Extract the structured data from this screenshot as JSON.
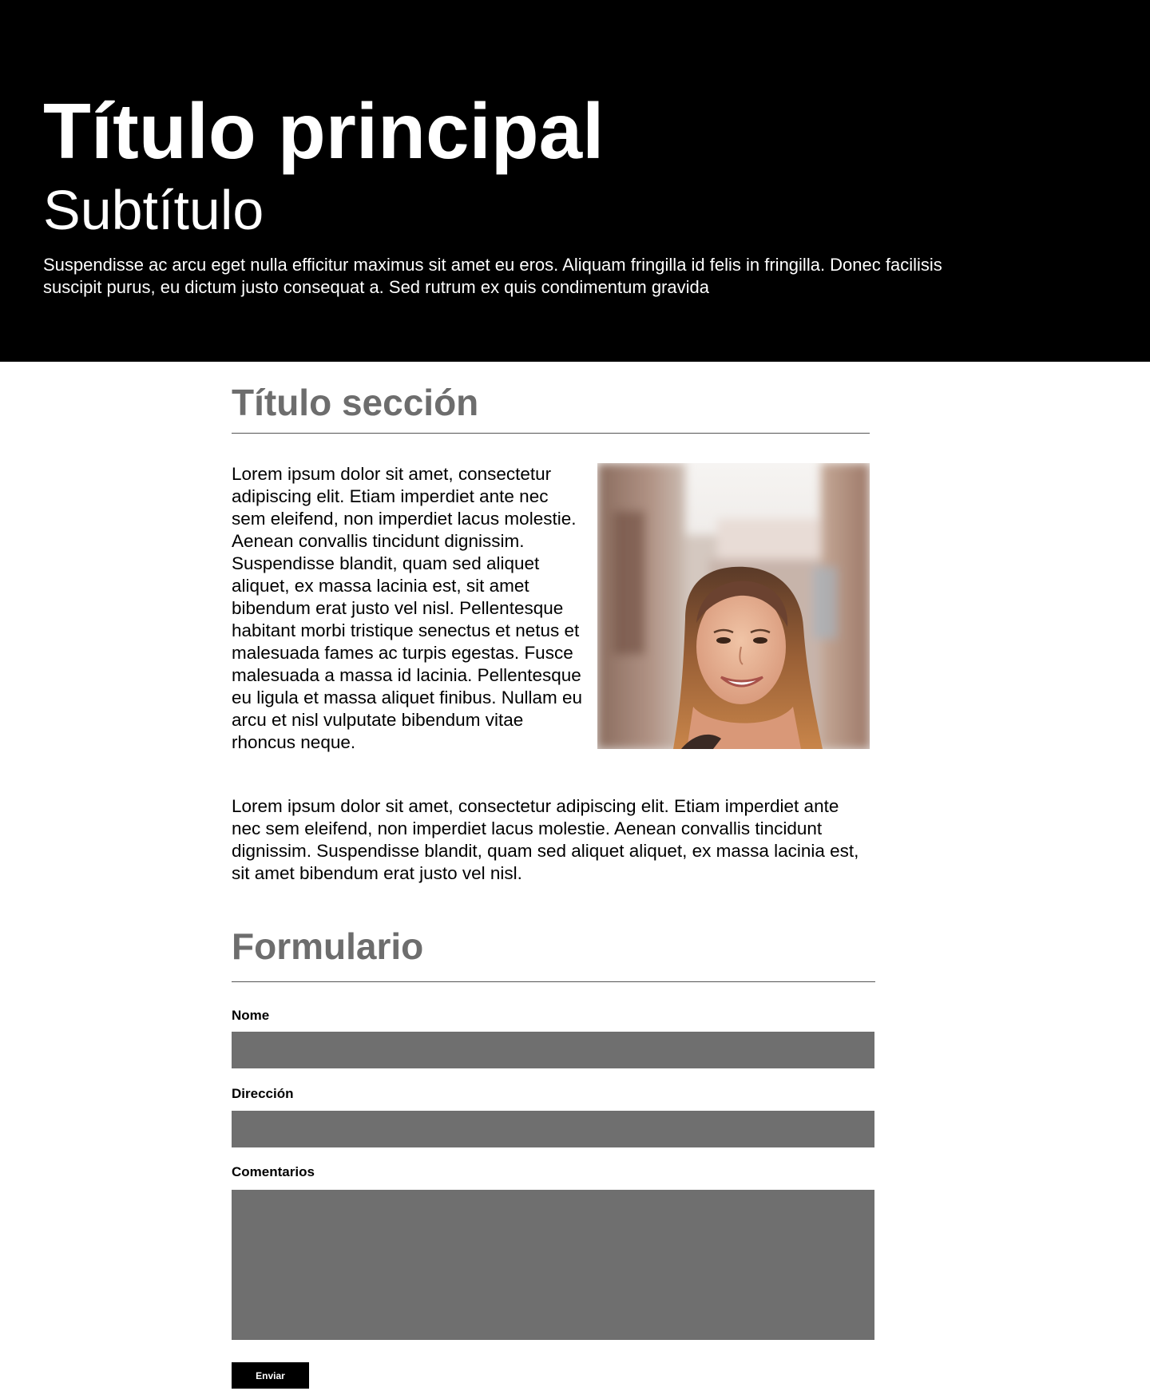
{
  "hero": {
    "title": "Título principal",
    "subtitle": "Subtítulo",
    "text": "Suspendisse ac arcu eget nulla efficitur maximus sit amet eu eros. Aliquam fringilla id felis in fringilla. Donec facilisis suscipit purus, eu dictum justo consequat a. Sed rutrum ex quis condimentum gravida",
    "background": "#000000"
  },
  "section": {
    "title": "Título sección",
    "paragraph1": "Lorem ipsum dolor sit amet, consectetur adipiscing elit. Etiam imperdiet ante nec sem eleifend, non imperdiet lacus molestie. Aenean convallis tincidunt dignissim. Suspendisse blandit, quam sed aliquet aliquet, ex massa lacinia est, sit amet bibendum erat justo vel nisl. Pellentesque habitant morbi tristique senectus et netus et malesuada fames ac turpis egestas. Fusce malesuada a massa id lacinia. Pellentesque eu ligula et massa aliquet finibus. Nullam eu arcu et nisl vulputate bibendum vitae rhoncus neque.",
    "paragraph2": "Lorem ipsum dolor sit amet, consectetur adipiscing elit. Etiam imperdiet ante nec sem eleifend, non imperdiet lacus molestie. Aenean convallis tincidunt dignissim. Suspendisse blandit, quam sed aliquet aliquet, ex massa lacinia est, sit amet bibendum erat justo vel nisl.",
    "title_color": "#6d6d6d"
  },
  "form": {
    "title": "Formulario",
    "fields": [
      {
        "label": "Nome",
        "value": ""
      },
      {
        "label": "Dirección",
        "value": ""
      },
      {
        "label": "Comentarios",
        "value": ""
      }
    ],
    "submit_label": "Enviar",
    "input_color": "#6f6f6f"
  }
}
